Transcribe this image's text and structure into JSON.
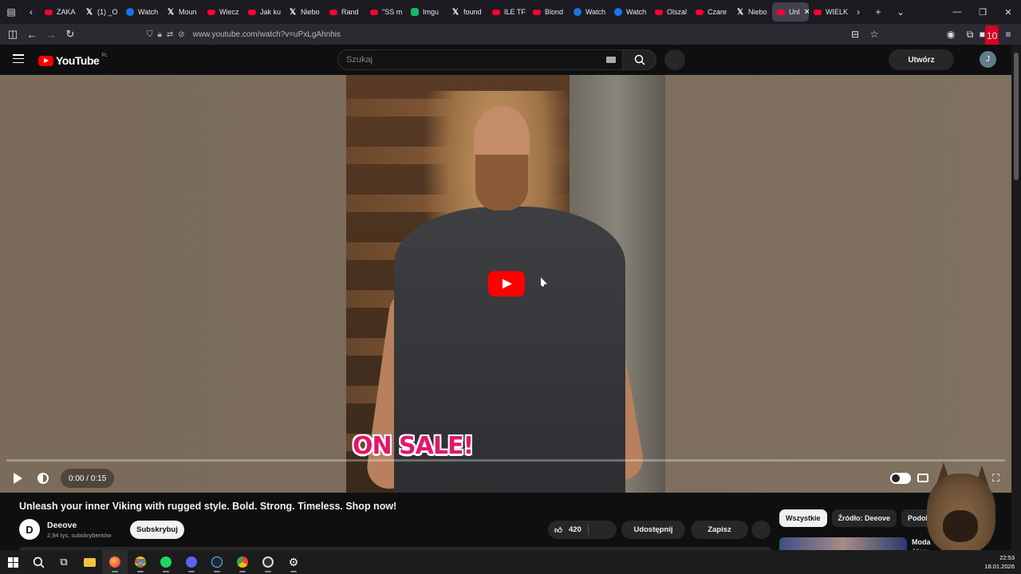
{
  "browser": {
    "tabs": [
      {
        "icon": "youtube-icon",
        "label": "ZAKA"
      },
      {
        "icon": "x-icon",
        "label": "(1) _O"
      },
      {
        "icon": "watch-icon",
        "label": "Watch"
      },
      {
        "icon": "x-icon",
        "label": "Moun"
      },
      {
        "icon": "youtube-icon",
        "label": "Wiecz"
      },
      {
        "icon": "youtube-icon",
        "label": "Jak ku"
      },
      {
        "icon": "x-icon",
        "label": "Niebo"
      },
      {
        "icon": "youtube-icon",
        "label": "Rand"
      },
      {
        "icon": "youtube-icon",
        "label": "\"SS m"
      },
      {
        "icon": "imgur-icon",
        "label": "Imgu"
      },
      {
        "icon": "x-icon",
        "label": "found"
      },
      {
        "icon": "youtube-icon",
        "label": "ILE TF"
      },
      {
        "icon": "youtube-icon",
        "label": "Blond"
      },
      {
        "icon": "watch-icon",
        "label": "Watch"
      },
      {
        "icon": "watch-icon",
        "label": "Watch"
      },
      {
        "icon": "youtube-icon",
        "label": "Olszal"
      },
      {
        "icon": "youtube-icon",
        "label": "Czare"
      },
      {
        "icon": "x-icon",
        "label": "Niebo"
      },
      {
        "icon": "youtube-icon",
        "label": "Unl"
      },
      {
        "icon": "youtube-icon",
        "label": "WIELK"
      }
    ],
    "active_tab_index": 18,
    "url": "www.youtube.com/watch?v=uPxLgAhnhis",
    "extension_badge": "10"
  },
  "youtube": {
    "logo_text": "YouTube",
    "region": "PL",
    "search_placeholder": "Szukaj",
    "create_label": "Utwórz",
    "avatar_letter": "J"
  },
  "player": {
    "overlay_text": "ON SALE!",
    "time": "0:00 / 0:15",
    "progress": 0
  },
  "video": {
    "title": "Unleash your inner Viking with rugged style. Bold. Strong. Timeless. Shop now!",
    "channel_name": "Deeove",
    "channel_initial": "D",
    "subscribers": "2,94 tys. subskrybentów",
    "subscribe_label": "Subskrybuj",
    "likes": "420",
    "share_label": "Udostępnij",
    "save_label": "Zapisz"
  },
  "sidebar": {
    "chips": [
      "Wszystkie",
      "Źródło: Deeove",
      "Podob"
    ],
    "related_title": "Moda",
    "related_subtitle": "Atlam"
  },
  "taskbar": {
    "time": "22:53",
    "date": "18.01.2026"
  },
  "colors": {
    "youtube_red": "#ff0000",
    "sale_pink": "#e0186c"
  }
}
